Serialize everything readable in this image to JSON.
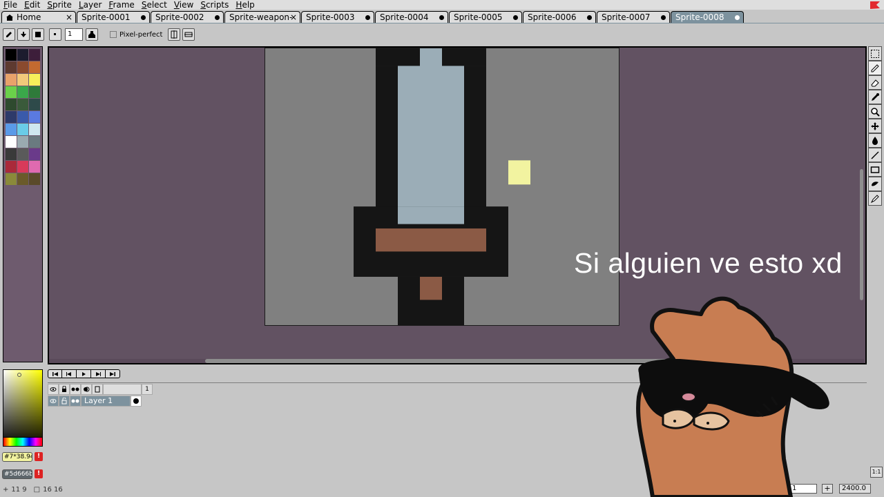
{
  "menu": [
    "File",
    "Edit",
    "Sprite",
    "Layer",
    "Frame",
    "Select",
    "View",
    "Scripts",
    "Help"
  ],
  "tabs": [
    {
      "label": "Home",
      "kind": "home",
      "close": "×"
    },
    {
      "label": "Sprite-0001",
      "kind": "modified"
    },
    {
      "label": "Sprite-0002",
      "kind": "modified"
    },
    {
      "label": "Sprite-weapon-",
      "kind": "close",
      "close": "×"
    },
    {
      "label": "Sprite-0003",
      "kind": "modified"
    },
    {
      "label": "Sprite-0004",
      "kind": "modified"
    },
    {
      "label": "Sprite-0005",
      "kind": "modified"
    },
    {
      "label": "Sprite-0006",
      "kind": "modified"
    },
    {
      "label": "Sprite-0007",
      "kind": "modified"
    },
    {
      "label": "Sprite-0008",
      "kind": "modified",
      "active": true
    }
  ],
  "context": {
    "brush_size": "1",
    "pixel_perfect_label": "Pixel-perfect"
  },
  "palette": [
    "#000000",
    "#1c1c2e",
    "#3d1e3a",
    "#5e3a30",
    "#8a4a2e",
    "#c36a30",
    "#e8a26a",
    "#f2c97a",
    "#f7f05a",
    "#6ad04a",
    "#3aa84a",
    "#2e7a3a",
    "#2e4a2e",
    "#3a5a3a",
    "#2e4a4a",
    "#2e3a6a",
    "#3a5aaa",
    "#5a7ae0",
    "#5a9ae8",
    "#6acce8",
    "#cfe8f0",
    "#ffffff",
    "#9aaab0",
    "#6a7a80",
    "#3a3a3a",
    "#5a5a5a",
    "#6a3a8a",
    "#aa2a3a",
    "#d83a5a",
    "#e06ab0",
    "#8a8a3a",
    "#6a5a2a",
    "#5a4a2a"
  ],
  "colors": {
    "foreground_hex": "#7*38.94",
    "background_hex": "#5d666b",
    "warn_symbol": "!",
    "canvas_bg": "#808080",
    "blade": "#9badb7",
    "outline": "#151515",
    "guard": "#8b5a45",
    "highlight": "#f2f3a0"
  },
  "timeline": {
    "frame_number": "1",
    "layer_name": "Layer 1"
  },
  "status": {
    "position": "11 9",
    "size": "16 16",
    "frame_input": "1",
    "zoom": "2400.0",
    "corner_label": "1:1"
  },
  "overlay": {
    "caption": "Si alguien ve esto xd"
  }
}
